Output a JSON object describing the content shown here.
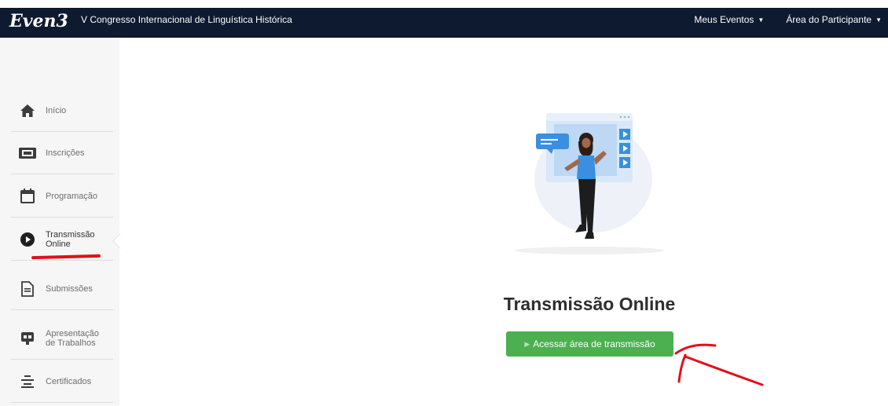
{
  "header": {
    "brand": "Even3",
    "event_title": "V Congresso Internacional de Linguística Histórica",
    "nav": [
      {
        "label": "Meus Eventos"
      },
      {
        "label": "Área do Participante"
      }
    ]
  },
  "sidebar": {
    "items": [
      {
        "label": "Início",
        "icon": "home-icon"
      },
      {
        "label": "Inscrições",
        "icon": "ticket-icon"
      },
      {
        "label": "Programação",
        "icon": "calendar-icon"
      },
      {
        "label_line1": "Transmissão",
        "label_line2": "Online",
        "icon": "play-circle-icon",
        "active": true
      },
      {
        "label": "Submissões",
        "icon": "document-icon"
      },
      {
        "label_line1": "Apresentação",
        "label_line2": "de Trabalhos",
        "icon": "presentation-icon"
      },
      {
        "label": "Certificados",
        "icon": "list-icon"
      }
    ]
  },
  "main": {
    "title": "Transmissão Online",
    "cta_label": "Acessar área de transmissão"
  },
  "colors": {
    "topbar": "#0e1a2f",
    "accent_green": "#4caf50",
    "annotation_red": "#e0101b",
    "illustration_blue": "#3a8fe0"
  }
}
